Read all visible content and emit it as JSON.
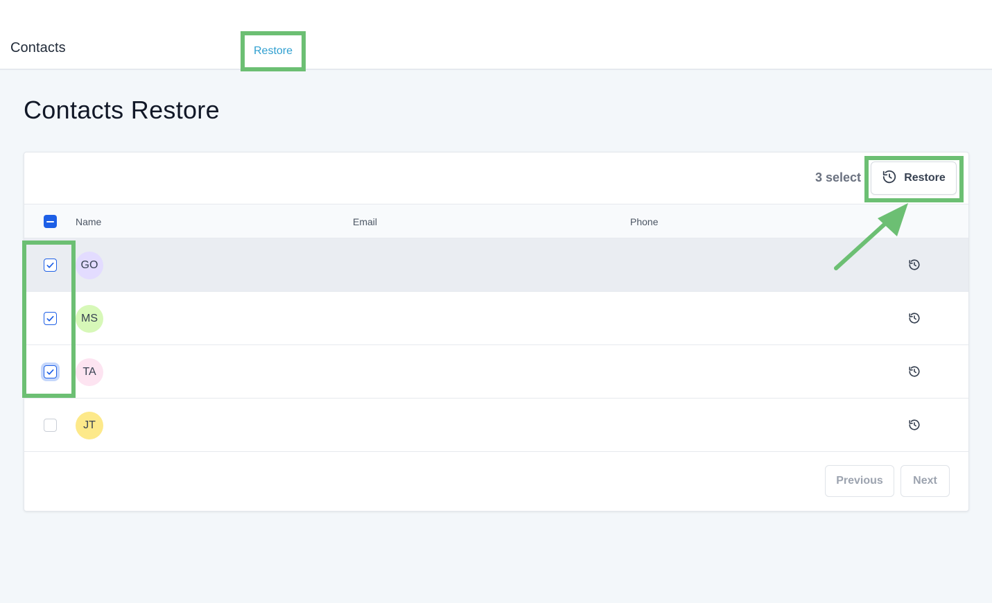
{
  "app": {
    "title": "Contacts"
  },
  "nav": {
    "tab_label": "Restore"
  },
  "page": {
    "title": "Contacts Restore"
  },
  "toolbar": {
    "select_count": "3 select",
    "restore_label": "Restore"
  },
  "table": {
    "columns": [
      "Name",
      "Email",
      "Phone"
    ],
    "rows": [
      {
        "initials": "GO",
        "avatar_color": "#e3dcff",
        "checked": true
      },
      {
        "initials": "MS",
        "avatar_color": "#d7f8b8",
        "checked": true
      },
      {
        "initials": "TA",
        "avatar_color": "#fde4f1",
        "checked": true
      },
      {
        "initials": "JT",
        "avatar_color": "#fde98a",
        "checked": false
      }
    ]
  },
  "pagination": {
    "previous": "Previous",
    "next": "Next"
  },
  "colors": {
    "accent": "#1d5fe6",
    "highlight": "#6cbf73",
    "link": "#2f9fd0"
  }
}
